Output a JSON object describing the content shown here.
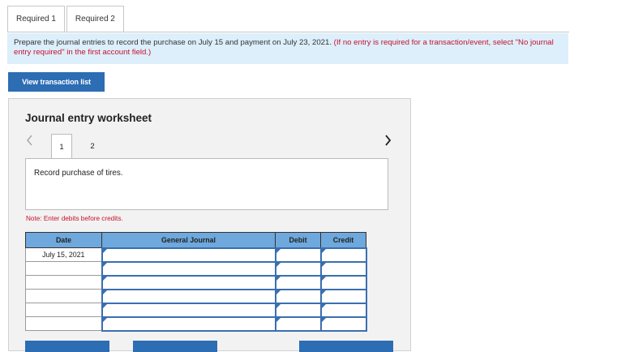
{
  "tabs": [
    {
      "label": "Required 1",
      "active": true
    },
    {
      "label": "Required 2",
      "active": false
    }
  ],
  "instructions": {
    "text": "Prepare the journal entries to record the purchase on July 15 and payment on July 23, 2021. ",
    "hint": "(If no entry is required for a transaction/event, select \"No journal entry required\" in the first account field.)"
  },
  "view_transaction_list_label": "View transaction list",
  "worksheet": {
    "title": "Journal entry worksheet",
    "prev_icon": "chevron-left-icon",
    "next_icon": "chevron-right-icon",
    "steps": [
      "1",
      "2"
    ],
    "active_step": "1",
    "description": "Record purchase of tires.",
    "note": "Note: Enter debits before credits."
  },
  "journal": {
    "headers": [
      "Date",
      "General Journal",
      "Debit",
      "Credit"
    ],
    "rows": [
      {
        "date": "July 15, 2021",
        "account": "",
        "debit": "",
        "credit": ""
      },
      {
        "date": "",
        "account": "",
        "debit": "",
        "credit": ""
      },
      {
        "date": "",
        "account": "",
        "debit": "",
        "credit": ""
      },
      {
        "date": "",
        "account": "",
        "debit": "",
        "credit": ""
      },
      {
        "date": "",
        "account": "",
        "debit": "",
        "credit": ""
      },
      {
        "date": "",
        "account": "",
        "debit": "",
        "credit": ""
      }
    ]
  },
  "colors": {
    "primary": "#2c6db4",
    "header_bg": "#6ea8dc",
    "instruction_bg": "#dceffb",
    "hint_red": "#c8102e",
    "panel_bg": "#f2f2f2"
  }
}
